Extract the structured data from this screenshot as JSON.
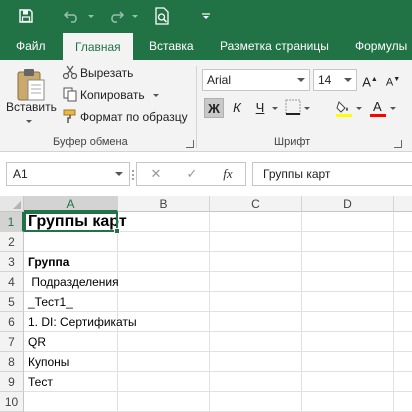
{
  "quick_access": {
    "save_icon": "save-icon",
    "undo_icon": "undo-icon",
    "redo_icon": "redo-icon",
    "print_preview_icon": "print-preview-icon",
    "customize_icon": "customize-quick-access-icon"
  },
  "tabs": [
    {
      "label": "Файл",
      "active": false
    },
    {
      "label": "Главная",
      "active": true
    },
    {
      "label": "Вставка",
      "active": false
    },
    {
      "label": "Разметка страницы",
      "active": false
    },
    {
      "label": "Формулы",
      "active": false
    }
  ],
  "clipboard": {
    "paste_label": "Вставить",
    "cut_label": "Вырезать",
    "copy_label": "Копировать",
    "format_painter_label": "Формат по образцу",
    "group_label": "Буфер обмена"
  },
  "font": {
    "font_name": "Arial",
    "font_size": "14",
    "bold_label": "Ж",
    "italic_label": "К",
    "underline_label": "Ч",
    "group_label": "Шрифт",
    "highlight_color": "#ffff00",
    "font_color": "#ff0000"
  },
  "formula_bar": {
    "name_box": "A1",
    "fx_label": "fx",
    "content": "Группы карт"
  },
  "grid": {
    "columns": [
      "A",
      "B",
      "C",
      "D"
    ],
    "selected_column": "A",
    "selected_row": 1,
    "rows": [
      {
        "number": "1",
        "a": "Группы карт",
        "style": "title"
      },
      {
        "number": "2",
        "a": "",
        "style": "normal"
      },
      {
        "number": "3",
        "a": "Группа",
        "style": "bold"
      },
      {
        "number": "4",
        "a": " Подразделения",
        "style": "normal"
      },
      {
        "number": "5",
        "a": "_Тест1_",
        "style": "normal"
      },
      {
        "number": "6",
        "a": "1. DI: Сертификаты",
        "style": "normal"
      },
      {
        "number": "7",
        "a": "QR",
        "style": "normal"
      },
      {
        "number": "8",
        "a": "Купоны",
        "style": "normal"
      },
      {
        "number": "9",
        "a": "Тест",
        "style": "normal"
      },
      {
        "number": "10",
        "a": "",
        "style": "normal"
      }
    ]
  },
  "colors": {
    "accent": "#217346",
    "ribbon_bg": "#f3f3f3"
  }
}
